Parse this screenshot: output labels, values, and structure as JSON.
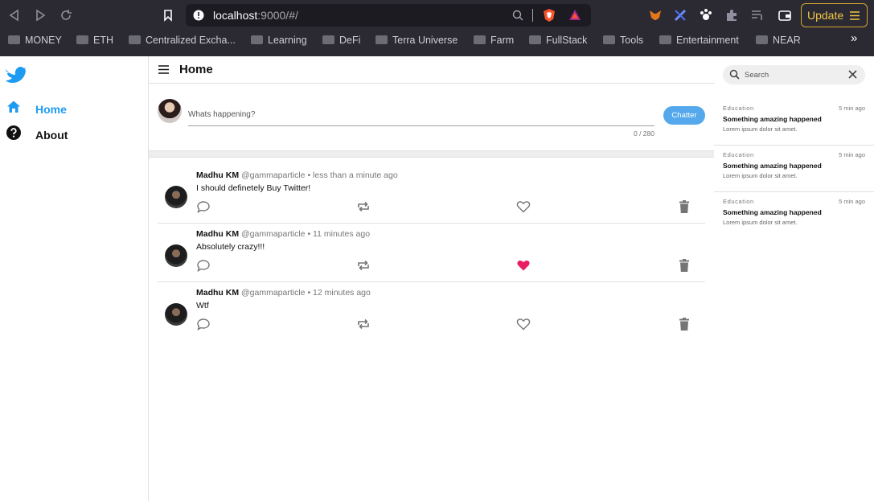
{
  "browser": {
    "url_host": "localhost",
    "url_rest": ":9000/#/",
    "update_label": "Update",
    "bookmarks": [
      "MONEY",
      "ETH",
      "Centralized Excha...",
      "Learning",
      "DeFi",
      "Terra Universe",
      "Farm",
      "FullStack",
      "Tools",
      "Entertainment",
      "NEAR"
    ],
    "overflow_label": "»"
  },
  "sidebar": {
    "items": [
      {
        "label": "Home",
        "icon": "home-icon",
        "active": true
      },
      {
        "label": "About",
        "icon": "help-icon",
        "active": false
      }
    ],
    "accent": "#1d9bf0"
  },
  "header": {
    "title": "Home"
  },
  "composer": {
    "placeholder": "Whats happening?",
    "counter": "0 / 280",
    "button_label": "Chatter"
  },
  "tweets": [
    {
      "name": "Madhu KM",
      "handle": "@gammaparticle",
      "time": "• less than a minute ago",
      "text": "I should definetely Buy Twitter!",
      "liked": false
    },
    {
      "name": "Madhu KM",
      "handle": "@gammaparticle",
      "time": "• 11 minutes ago",
      "text": "Absolutely crazy!!!",
      "liked": true
    },
    {
      "name": "Madhu KM",
      "handle": "@gammaparticle",
      "time": "• 12 minutes ago",
      "text": "Wtf",
      "liked": false
    }
  ],
  "search": {
    "placeholder": "Search"
  },
  "trends": [
    {
      "category": "Education",
      "time": "5 min ago",
      "headline": "Something amazing happened",
      "body": "Lorem ipsum dolor sit amet."
    },
    {
      "category": "Education",
      "time": "5 min ago",
      "headline": "Something amazing happened",
      "body": "Lorem ipsum dolor sit amet."
    },
    {
      "category": "Education",
      "time": "5 min ago",
      "headline": "Something amazing happened",
      "body": "Lorem ipsum dolor sit amet."
    }
  ],
  "colors": {
    "like_active": "#e91e63",
    "button": "#55a8ec",
    "update": "#f1c644"
  }
}
